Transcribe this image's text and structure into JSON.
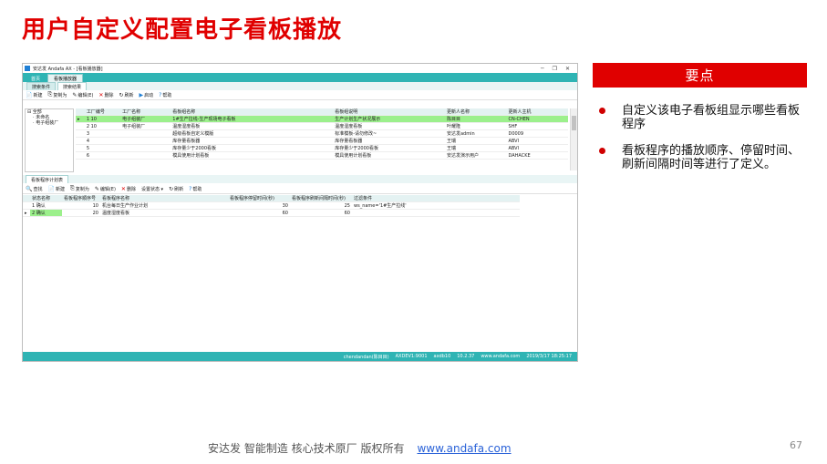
{
  "slide": {
    "title": "用户自定义配置电子看板播放",
    "key_points_header": "要点",
    "key_points": [
      "自定义该电子看板组显示哪些看板程序",
      "看板程序的播放顺序、停留时间、刷新间隔时间等进行了定义。"
    ],
    "footer_text": "安达发  智能制造 核心技术原厂  版权所有",
    "footer_link": "www.andafa.com",
    "page_number": "67"
  },
  "app": {
    "window_title": "安达发 Andafa AX - [看板播放器]",
    "window_controls": [
      "─",
      "❐",
      "✕"
    ],
    "menu_tabs": [
      "首页",
      "看板播放器"
    ],
    "subtabs": [
      "搜索条件",
      "搜索结果"
    ],
    "toolbar": [
      "新建",
      "复制为",
      "编辑(E)",
      "删除",
      "刷新",
      "启动",
      "帮助"
    ],
    "tree": [
      "全部",
      "未命名",
      "电子组装厂"
    ],
    "table1": {
      "columns": [
        "",
        "工厂编号",
        "工厂名称",
        "看板组名称",
        "看板组说明",
        "更新人名称",
        "更新人主机"
      ],
      "rows": [
        [
          "▸",
          "1  10",
          "电子组装厂",
          "1#生产拉线-生产现场电子看板",
          "生产计划生产状况展示",
          "陈目目",
          "CN-CHEN"
        ],
        [
          "",
          "2  10",
          "电子组装厂",
          "温度湿度看板",
          "温度湿度看板",
          "叶耀隆",
          "SHF"
        ],
        [
          "",
          "3",
          "",
          "超级看板自定义模版",
          "标准模板-请勿修改~",
          "安达发admin",
          "D0009"
        ],
        [
          "",
          "4",
          "",
          "库存量看板器",
          "库存量看板器",
          "王瑞",
          "ABVI"
        ],
        [
          "",
          "5",
          "",
          "库存量少于2000看板",
          "库存量少于2000看板",
          "王瑞",
          "ABVI"
        ],
        [
          "",
          "6",
          "",
          "模具使用计划看板",
          "模具使用计划看板",
          "安达发演示用户",
          "DAHACKE"
        ]
      ]
    },
    "lower_tab": "看板程序计划表",
    "toolbar2": [
      "查找",
      "新建",
      "复制为",
      "编辑(E)",
      "删除",
      "设置状态 ▾",
      "刷新",
      "帮助"
    ],
    "table2": {
      "columns": [
        "",
        "状态名称",
        "看板程序顺序号",
        "看板程序名称",
        "看板程序停留时间(秒)",
        "看板程序刷新间隔时间(秒)",
        "过滤条件"
      ],
      "rows": [
        [
          "",
          "1  确认",
          "10",
          "机台每日生产作业计划",
          "30",
          "25",
          "ws_name='1#生产拉线'"
        ],
        [
          "▸",
          "2  确认",
          "20",
          "温度湿度看板",
          "60",
          "60",
          ""
        ]
      ]
    },
    "statusbar": [
      "chendandan(陈目目)",
      "AXDEV1:9001",
      "axdb10",
      "10.2.37",
      "www.andafa.com",
      "2019/3/17 18:25:17"
    ]
  },
  "colors": {
    "accent_red": "#e00000",
    "app_teal": "#2fb4b4",
    "highlight_green": "#9cf08c"
  }
}
